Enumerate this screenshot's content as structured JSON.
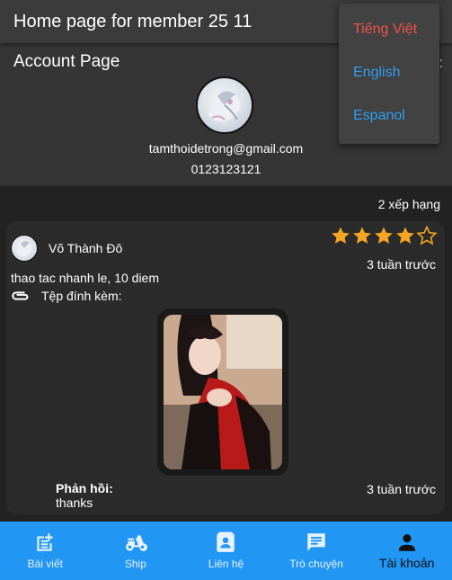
{
  "header": {
    "title": "Home page for member 25 11"
  },
  "account": {
    "title": "Account Page",
    "email": "tamthoidetrong@gmail.com",
    "phone": "0123123121"
  },
  "language_menu": {
    "items": [
      {
        "label": "Tiếng Việt",
        "color": "#f0524b"
      },
      {
        "label": "English",
        "color": "#2f9df0"
      },
      {
        "label": "Espanol",
        "color": "#2f9df0"
      }
    ]
  },
  "reviews": {
    "count_label": "2 xếp hạng",
    "items": [
      {
        "reviewer": "Võ Thành Đô",
        "rating": 4,
        "rating_max": 5,
        "time": "3  tuần trước",
        "text": "thao tac nhanh le, 10 diem",
        "attachment_label": "Tệp đính kèm:",
        "reply_label": "Phản hồi:",
        "reply_text": "thanks",
        "reply_time": "3  tuần trước"
      }
    ]
  },
  "bottom_nav": {
    "items": [
      {
        "label": "Bài viết",
        "icon": "post-add-icon",
        "active": false
      },
      {
        "label": "Ship",
        "icon": "scooter-icon",
        "active": false
      },
      {
        "label": "Liên hệ",
        "icon": "contact-card-icon",
        "active": false
      },
      {
        "label": "Trò chuyện",
        "icon": "chat-icon",
        "active": false
      },
      {
        "label": "Tài khoản",
        "icon": "person-icon",
        "active": true
      }
    ]
  },
  "colors": {
    "accent": "#2196f3",
    "star": "#f5a623",
    "language_selected": "#f0524b",
    "language_option": "#2f9df0"
  }
}
